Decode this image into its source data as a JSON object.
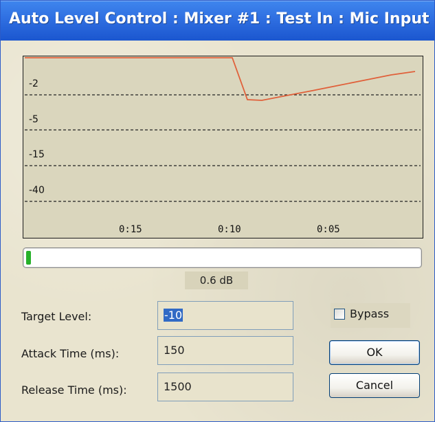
{
  "window": {
    "title": "Auto Level Control : Mixer #1 : Test In : Mic Input"
  },
  "graph": {
    "y_labels": [
      "-2",
      "-5",
      "-15",
      "-40"
    ],
    "x_labels": [
      "0:15",
      "0:10",
      "0:05"
    ],
    "line_color": "#e0603a",
    "grid_color": "#222222"
  },
  "meter": {
    "level": 0.012,
    "fill_color": "#27b12a",
    "value_text": "0.6 dB"
  },
  "fields": {
    "target_level": {
      "label": "Target Level:",
      "value": "-10"
    },
    "attack_time": {
      "label": "Attack Time (ms):",
      "value": "150"
    },
    "release_time": {
      "label": "Release Time (ms):",
      "value": "1500"
    }
  },
  "bypass": {
    "label": "Bypass",
    "checked": false
  },
  "buttons": {
    "ok": "OK",
    "cancel": "Cancel"
  },
  "colors": {
    "title_bar": "#2f6fe1",
    "panel": "#e9e4cf",
    "graph_bg": "#dad6bd"
  }
}
